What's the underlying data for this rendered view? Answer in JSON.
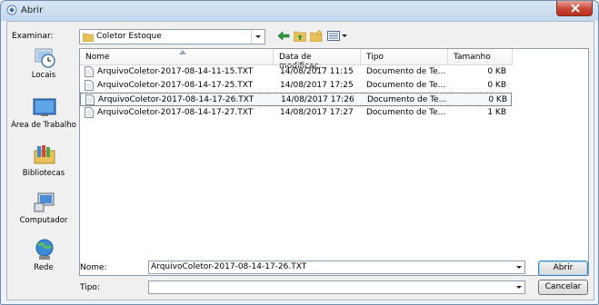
{
  "window": {
    "title": "Abrir"
  },
  "toolbar": {
    "look_in_label": "Examinar:",
    "look_in_value": "Coletor Estoque"
  },
  "places": [
    {
      "label": "Locais",
      "icon": "recent-places-icon"
    },
    {
      "label": "Área de Trabalho",
      "icon": "desktop-icon"
    },
    {
      "label": "Bibliotecas",
      "icon": "libraries-icon"
    },
    {
      "label": "Computador",
      "icon": "computer-icon"
    },
    {
      "label": "Rede",
      "icon": "network-icon"
    }
  ],
  "columns": {
    "name": "Nome",
    "date": "Data de modificaç...",
    "type": "Tipo",
    "size": "Tamanho"
  },
  "files": [
    {
      "name": "ArquivoColetor-2017-08-14-11-15.TXT",
      "date": "14/08/2017 11:15",
      "type": "Documento de Te...",
      "size": "0 KB",
      "selected": false
    },
    {
      "name": "ArquivoColetor-2017-08-14-17-25.TXT",
      "date": "14/08/2017 17:25",
      "type": "Documento de Te...",
      "size": "0 KB",
      "selected": false
    },
    {
      "name": "ArquivoColetor-2017-08-14-17-26.TXT",
      "date": "14/08/2017 17:26",
      "type": "Documento de Te...",
      "size": "0 KB",
      "selected": true
    },
    {
      "name": "ArquivoColetor-2017-08-14-17-27.TXT",
      "date": "14/08/2017 17:27",
      "type": "Documento de Te...",
      "size": "1 KB",
      "selected": false
    }
  ],
  "footer": {
    "name_label": "Nome:",
    "name_value": "ArquivoColetor-2017-08-14-17-26.TXT",
    "type_label": "Tipo:",
    "type_value": "",
    "open_button": "Abrir",
    "cancel_button": "Cancelar"
  },
  "colors": {
    "selection_border": "#9fb9d6",
    "close_button": "#c94634",
    "title_gradient": "#c3d8ee"
  }
}
